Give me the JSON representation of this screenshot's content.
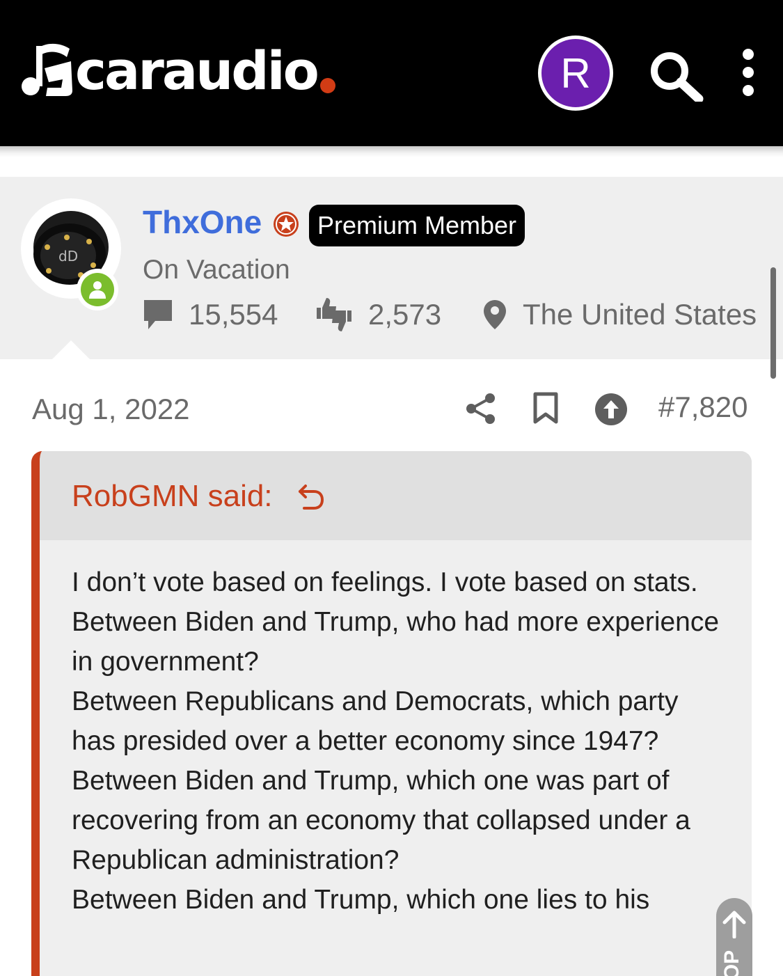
{
  "header": {
    "logo_text": "caraudio",
    "avatar_initial": "R",
    "avatar_color": "#6b1fae",
    "icons": [
      "logo-music-note-icon",
      "search-icon",
      "more-vertical-icon"
    ]
  },
  "user": {
    "name": "ThxOne",
    "name_color": "#3f6ddb",
    "staff_icon": "star-badge-icon",
    "badge": "Premium Member",
    "status": "On Vacation",
    "online": true,
    "messages": "15,554",
    "reaction_score": "2,573",
    "location": "The United States"
  },
  "post": {
    "date": "Aug 1, 2022",
    "number": "#7,820",
    "actions": [
      "share-icon",
      "bookmark-icon",
      "upvote-icon"
    ]
  },
  "quote": {
    "author": "RobGMN said:",
    "accent_color": "#c8401c",
    "lines": [
      "I don’t vote based on feelings. I vote based on stats.",
      "Between Biden and Trump, who had more experience in government?",
      "Between Republicans and Democrats, which party has presided over a better economy since 1947?",
      "Between Biden and Trump, which one was part of recovering from an economy that collapsed under a Republican administration?",
      "Between Biden and Trump, which one lies to his"
    ]
  },
  "back_to_top": {
    "label": "TOP"
  }
}
